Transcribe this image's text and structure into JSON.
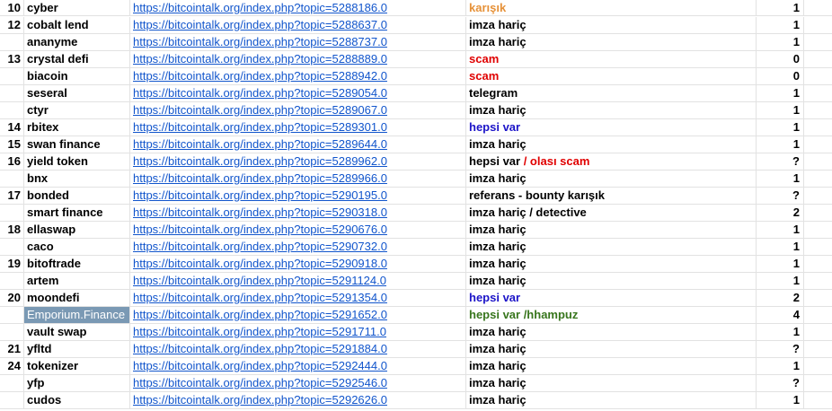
{
  "colors": {
    "link": "#1155cc",
    "orange": "#e69138",
    "red": "#e00000",
    "blue": "#1c14c8",
    "green": "#38761d",
    "selected_cell_bg": "#7a99b4"
  },
  "rows": [
    {
      "num": "10",
      "name": "cyber",
      "url": "https://bitcointalk.org/index.php?topic=5288186.0",
      "note": [
        {
          "text": "karışık",
          "color": "orange"
        }
      ],
      "value": "1"
    },
    {
      "num": "12",
      "name": "cobalt lend",
      "url": "https://bitcointalk.org/index.php?topic=5288637.0",
      "note": [
        {
          "text": "imza hariç",
          "color": "black"
        }
      ],
      "value": "1"
    },
    {
      "num": "",
      "name": "ananyme",
      "url": "https://bitcointalk.org/index.php?topic=5288737.0",
      "note": [
        {
          "text": "imza hariç",
          "color": "black"
        }
      ],
      "value": "1"
    },
    {
      "num": "13",
      "name": "crystal defi",
      "url": "https://bitcointalk.org/index.php?topic=5288889.0",
      "note": [
        {
          "text": "scam",
          "color": "red"
        }
      ],
      "value": "0"
    },
    {
      "num": "",
      "name": "biacoin",
      "url": "https://bitcointalk.org/index.php?topic=5288942.0",
      "note": [
        {
          "text": "scam",
          "color": "red"
        }
      ],
      "value": "0"
    },
    {
      "num": "",
      "name": "seseral",
      "url": "https://bitcointalk.org/index.php?topic=5289054.0",
      "note": [
        {
          "text": "telegram",
          "color": "black"
        }
      ],
      "value": "1"
    },
    {
      "num": "",
      "name": "ctyr",
      "url": "https://bitcointalk.org/index.php?topic=5289067.0",
      "note": [
        {
          "text": "imza hariç",
          "color": "black"
        }
      ],
      "value": "1"
    },
    {
      "num": "14",
      "name": "rbitex",
      "url": "https://bitcointalk.org/index.php?topic=5289301.0",
      "note": [
        {
          "text": "hepsi var",
          "color": "blue"
        }
      ],
      "value": "1"
    },
    {
      "num": "15",
      "name": "swan finance",
      "url": "https://bitcointalk.org/index.php?topic=5289644.0",
      "note": [
        {
          "text": "imza hariç",
          "color": "black"
        }
      ],
      "value": "1"
    },
    {
      "num": "16",
      "name": "yield token",
      "url": "https://bitcointalk.org/index.php?topic=5289962.0",
      "note": [
        {
          "text": "hepsi var",
          "color": "black"
        },
        {
          "text": " / olası scam",
          "color": "red"
        }
      ],
      "value": "?"
    },
    {
      "num": "",
      "name": "bnx",
      "url": "https://bitcointalk.org/index.php?topic=5289966.0",
      "note": [
        {
          "text": "imza hariç",
          "color": "black"
        }
      ],
      "value": "1"
    },
    {
      "num": "17",
      "name": "bonded",
      "url": "https://bitcointalk.org/index.php?topic=5290195.0",
      "note": [
        {
          "text": "referans - bounty karışık",
          "color": "black"
        }
      ],
      "value": "?"
    },
    {
      "num": "",
      "name": "smart finance",
      "url": "https://bitcointalk.org/index.php?topic=5290318.0",
      "note": [
        {
          "text": "imza hariç / detective",
          "color": "black"
        }
      ],
      "value": "2"
    },
    {
      "num": "18",
      "name": "ellaswap",
      "url": "https://bitcointalk.org/index.php?topic=5290676.0",
      "note": [
        {
          "text": "imza hariç",
          "color": "black"
        }
      ],
      "value": "1"
    },
    {
      "num": "",
      "name": "caco",
      "url": "https://bitcointalk.org/index.php?topic=5290732.0",
      "note": [
        {
          "text": "imza hariç",
          "color": "black"
        }
      ],
      "value": "1"
    },
    {
      "num": "19",
      "name": "bitoftrade",
      "url": "https://bitcointalk.org/index.php?topic=5290918.0",
      "note": [
        {
          "text": "imza hariç",
          "color": "black"
        }
      ],
      "value": "1"
    },
    {
      "num": "",
      "name": "artem",
      "url": "https://bitcointalk.org/index.php?topic=5291124.0",
      "note": [
        {
          "text": "imza hariç",
          "color": "black"
        }
      ],
      "value": "1"
    },
    {
      "num": "20",
      "name": "moondefi",
      "url": "https://bitcointalk.org/index.php?topic=5291354.0",
      "note": [
        {
          "text": "hepsi var",
          "color": "blue"
        }
      ],
      "value": "2"
    },
    {
      "num": "",
      "name": "Emporium.Finance",
      "url": "https://bitcointalk.org/index.php?topic=5291652.0",
      "note": [
        {
          "text": "hepsi var /hhampuz",
          "color": "green"
        }
      ],
      "value": "4",
      "selected": true
    },
    {
      "num": "",
      "name": "vault swap",
      "url": "https://bitcointalk.org/index.php?topic=5291711.0",
      "note": [
        {
          "text": "imza hariç",
          "color": "black"
        }
      ],
      "value": "1"
    },
    {
      "num": "21",
      "name": "yfltd",
      "url": "https://bitcointalk.org/index.php?topic=5291884.0",
      "note": [
        {
          "text": "imza hariç",
          "color": "black"
        }
      ],
      "value": "?"
    },
    {
      "num": "24",
      "name": "tokenizer",
      "url": "https://bitcointalk.org/index.php?topic=5292444.0",
      "note": [
        {
          "text": "imza hariç",
          "color": "black"
        }
      ],
      "value": "1"
    },
    {
      "num": "",
      "name": "yfp",
      "url": "https://bitcointalk.org/index.php?topic=5292546.0",
      "note": [
        {
          "text": "imza hariç",
          "color": "black"
        }
      ],
      "value": "?"
    },
    {
      "num": "",
      "name": "cudos",
      "url": "https://bitcointalk.org/index.php?topic=5292626.0",
      "note": [
        {
          "text": "imza hariç",
          "color": "black"
        }
      ],
      "value": "1"
    }
  ]
}
